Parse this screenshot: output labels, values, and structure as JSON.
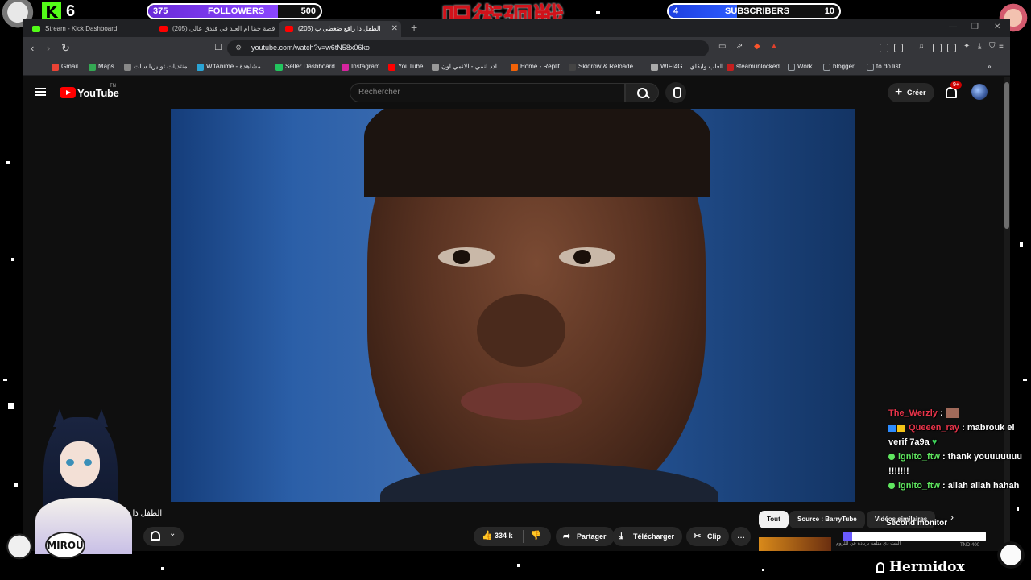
{
  "overlay": {
    "kick_count": "6",
    "followers": {
      "current": "375",
      "label": "FOLLOWERS",
      "goal": "500",
      "progress": 0.75
    },
    "subscribers": {
      "current": "4",
      "label": "SUBSCRIBERS",
      "goal": "10",
      "progress": 0.4
    },
    "jjk_logo": "呪術廻戦",
    "mirou_label": "MIROU",
    "second_monitor": "Second monitor",
    "hermidox": "Hermidox",
    "chat": [
      {
        "user": "The_Werzly",
        "text": "",
        "color": "red"
      },
      {
        "user": "Queeen_ray",
        "text": "mabrouk el verif 7a9a",
        "color": "red"
      },
      {
        "user": "ignito_ftw",
        "text": "thank youuuuuuu !!!!!!!",
        "color": "green"
      },
      {
        "user": "ignito_ftw",
        "text": "allah allah hahah",
        "color": "green"
      }
    ]
  },
  "browser": {
    "tabs": [
      {
        "title": "Stream - Kick Dashboard",
        "icon_color": "#53fc18"
      },
      {
        "title": "(205) قصة جبنا ام العيد في فندق عالي",
        "icon_color": "#ff0000"
      },
      {
        "title": "(205) الطفل ذا رافع ضغطي ب",
        "icon_color": "#ff0000"
      }
    ],
    "new_tab": "+",
    "url": "youtube.com/watch?v=w6tN58x06ko",
    "bookmarks": [
      {
        "label": "Gmail",
        "color": "#ea4335"
      },
      {
        "label": "Maps",
        "color": "#34a853"
      },
      {
        "label": "منتديات تونيزيا سات",
        "color": "#888888"
      },
      {
        "label": "WitAnime - مشاهدة...",
        "color": "#2aa4d5"
      },
      {
        "label": "Seller Dashboard",
        "color": "#22c55e"
      },
      {
        "label": "Instagram",
        "color": "#d6249f"
      },
      {
        "label": "YouTube",
        "color": "#ff0000"
      },
      {
        "label": "ادد انمي - الانمي اون...",
        "color": "#999999"
      },
      {
        "label": "Home - Replit",
        "color": "#f26207"
      },
      {
        "label": "Skidrow & Reloade...",
        "color": "#444444"
      },
      {
        "label": "WIFI4G... العاب وابقاي",
        "color": "#aaaaaa"
      },
      {
        "label": "steamunlocked",
        "color": "#c41e1e"
      },
      {
        "label": "Work",
        "color": "#9aa0a6"
      },
      {
        "label": "blogger",
        "color": "#9aa0a6"
      },
      {
        "label": "to do list",
        "color": "#9aa0a6"
      }
    ]
  },
  "youtube": {
    "logo_text": "YouTube",
    "logo_tm": "TN",
    "search_placeholder": "Rechercher",
    "create_label": "Créer",
    "notif_badge": "9+",
    "video_title": "الطفل ذا رافع",
    "likes": "334 k",
    "share": "Partager",
    "download": "Télécharger",
    "clip": "Clip",
    "more": "...",
    "chips": [
      "Tout",
      "Source : BarryTube",
      "Vidéos similaires"
    ],
    "related_count": "TND 400",
    "related_meta": "البنت دي متلمة بزيادة عن اللزوم"
  }
}
